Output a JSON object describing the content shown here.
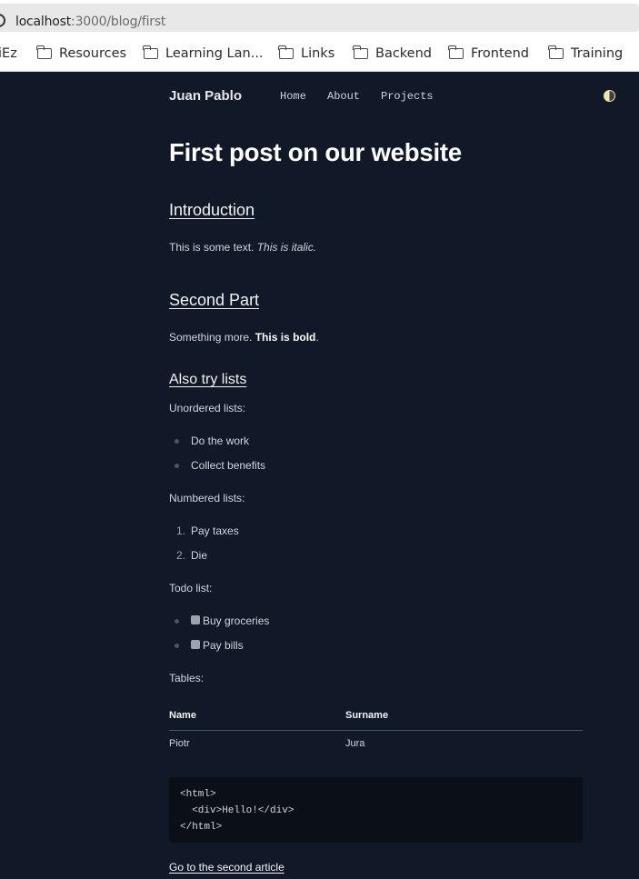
{
  "browser": {
    "url_host": "localhost",
    "url_path": ":3000/blog/first",
    "bookmarks": [
      "iEz",
      "Resources",
      "Learning Lan...",
      "Links",
      "Backend",
      "Frontend",
      "Training"
    ]
  },
  "nav": {
    "brand": "Juan Pablo",
    "links": [
      "Home",
      "About",
      "Projects"
    ],
    "theme_icon": "half-moon-toggle-icon"
  },
  "post": {
    "title": "First post on our website",
    "intro_heading": "Introduction",
    "intro_text": "This is some text. ",
    "intro_italic": "This is italic.",
    "second_heading": "Second Part",
    "second_text": "Something more. ",
    "second_bold": "This is bold",
    "second_end": ".",
    "lists_heading": "Also try lists",
    "unordered_label": "Unordered lists:",
    "unordered": [
      "Do the work",
      "Collect benefits"
    ],
    "numbered_label": "Numbered lists:",
    "numbered": [
      {
        "n": "1.",
        "text": "Pay taxes"
      },
      {
        "n": "2.",
        "text": "Die"
      }
    ],
    "todo_label": "Todo list:",
    "todo": [
      "Buy groceries",
      "Pay bills"
    ],
    "tables_label": "Tables:",
    "table": {
      "headers": [
        "Name",
        "Surname"
      ],
      "rows": [
        [
          "Piotr",
          "Jura"
        ]
      ]
    },
    "code_lines": [
      "<html>",
      "  <div>Hello!</div>",
      "</html>"
    ],
    "next_link": "Go to the second article"
  },
  "colors": {
    "background": "#111827",
    "code_background": "#0b0f17"
  }
}
